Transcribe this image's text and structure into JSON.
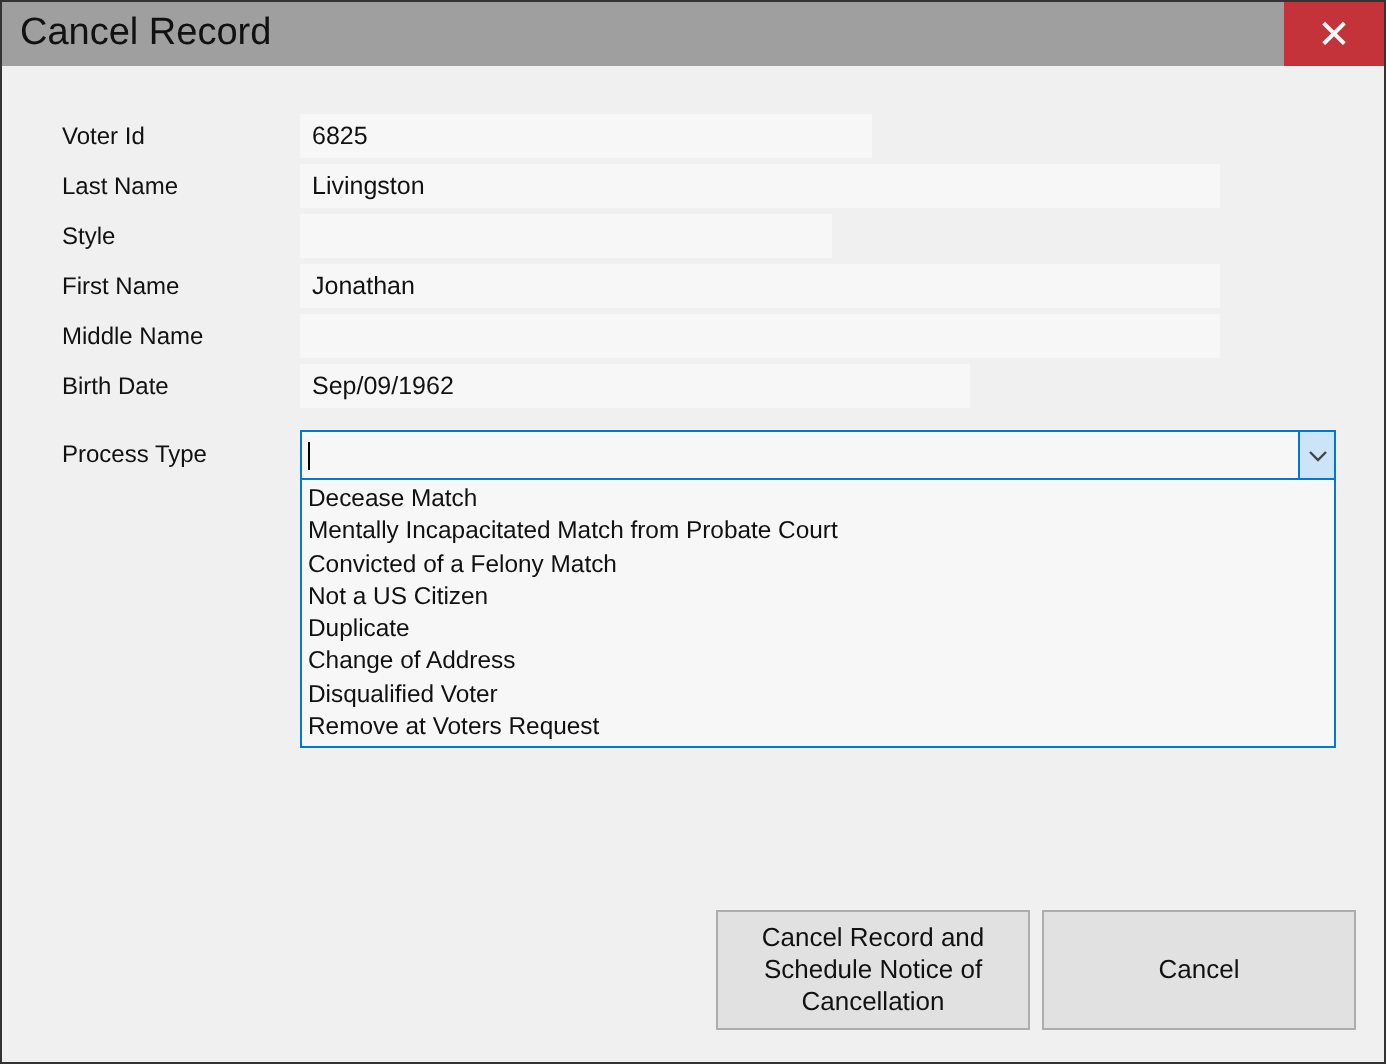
{
  "window": {
    "title": "Cancel Record",
    "close": "✕"
  },
  "fields": [
    {
      "label": "Voter Id",
      "value": "6825"
    },
    {
      "label": "Last Name",
      "value": "Livingston"
    },
    {
      "label": "Style"
    },
    {
      "label": "First Name",
      "value": "Jonathan"
    },
    {
      "label": "Middle Name"
    },
    {
      "label": "Birth Date",
      "value": "Sep/09/1962"
    }
  ],
  "process_type": {
    "label": "Process Type",
    "expanded": true,
    "options": [
      {
        "label": "Decease Match",
        "selected": false
      },
      {
        "label": "Mentally Incapacitated Match from Probate Court",
        "selected": false
      },
      {
        "label": "Convicted of a Felony Match",
        "selected": false
      },
      {
        "label": "Not a US Citizen",
        "selected": false
      },
      {
        "label": "Duplicate",
        "selected": false
      },
      {
        "label": "Change of Address",
        "selected": false
      },
      {
        "label": "Disqualified Voter",
        "selected": false
      },
      {
        "label": "Remove at Voters Request",
        "selected": false
      }
    ]
  },
  "buttons": [
    "Cancel Record and Schedule Notice of Cancellation",
    "Cancel"
  ]
}
